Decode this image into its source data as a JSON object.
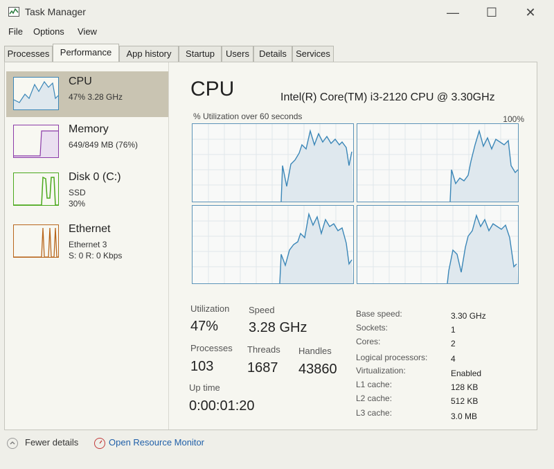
{
  "window": {
    "title": "Task Manager",
    "minimize": "—",
    "maximize": "☐",
    "close": "✕"
  },
  "menu": [
    "File",
    "Options",
    "View"
  ],
  "tabs": [
    "Processes",
    "Performance",
    "App history",
    "Startup",
    "Users",
    "Details",
    "Services"
  ],
  "active_tab": "Performance",
  "sidebar": [
    {
      "title": "CPU",
      "line1": "47%  3.28 GHz",
      "line2": "",
      "color": "#3a86b7"
    },
    {
      "title": "Memory",
      "line1": "649/849 MB (76%)",
      "line2": "",
      "color": "#8b3aa8"
    },
    {
      "title": "Disk 0 (C:)",
      "line1": "SSD",
      "line2": "30%",
      "color": "#4aa81c"
    },
    {
      "title": "Ethernet",
      "line1": "Ethernet 3",
      "line2": "S: 0 R: 0 Kbps",
      "color": "#b8661c"
    }
  ],
  "cpu": {
    "heading": "CPU",
    "model": "Intel(R) Core(TM) i3-2120 CPU @ 3.30GHz",
    "graph_caption": "% Utilization over 60 seconds",
    "graph_max": "100%",
    "stats": {
      "utilization_label": "Utilization",
      "utilization": "47%",
      "speed_label": "Speed",
      "speed": "3.28 GHz",
      "processes_label": "Processes",
      "processes": "103",
      "threads_label": "Threads",
      "threads": "1687",
      "handles_label": "Handles",
      "handles": "43860",
      "uptime_label": "Up time",
      "uptime": "0:00:01:20"
    },
    "specs": [
      {
        "label": "Base speed:",
        "value": "3.30 GHz"
      },
      {
        "label": "Sockets:",
        "value": "1"
      },
      {
        "label": "Cores:",
        "value": "2"
      },
      {
        "label": "Logical processors:",
        "value": "4"
      },
      {
        "label": "Virtualization:",
        "value": "Enabled"
      },
      {
        "label": "L1 cache:",
        "value": "128 KB"
      },
      {
        "label": "L2 cache:",
        "value": "512 KB"
      },
      {
        "label": "L3 cache:",
        "value": "3.0 MB"
      }
    ]
  },
  "footer": {
    "fewer_details": "Fewer details",
    "resource_monitor": "Open Resource Monitor"
  },
  "colors": {
    "cpu_graph": "#3a86b7",
    "graph_fill": "#dfe8ee",
    "link": "#1f5fa8"
  }
}
